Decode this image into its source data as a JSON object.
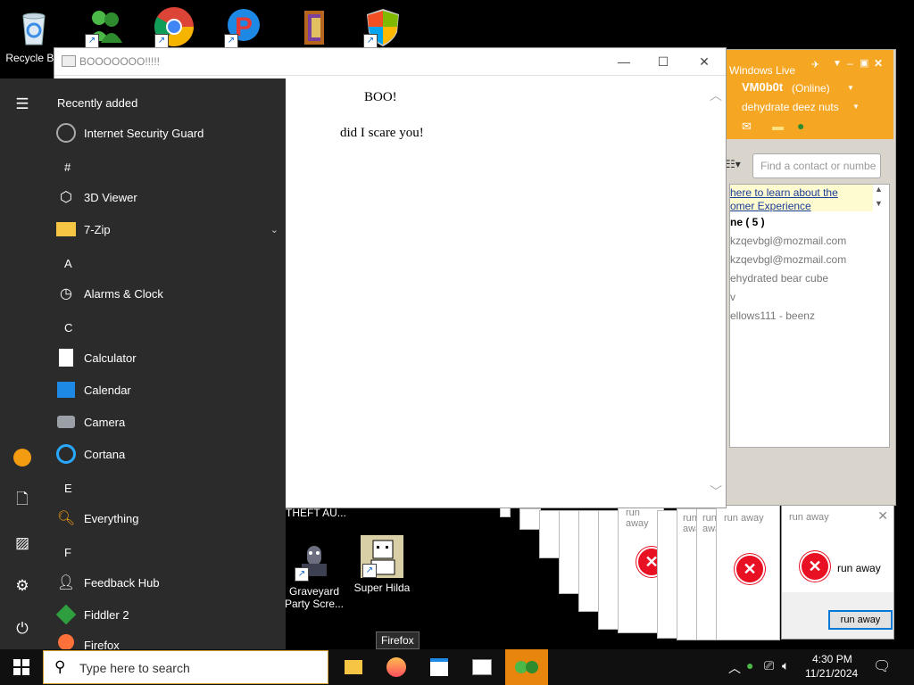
{
  "desktop": {
    "icons": [
      {
        "label": "Recycle Bin",
        "name": "recycle-bin"
      },
      {
        "label": "",
        "name": "messenger"
      },
      {
        "label": "",
        "name": "chrome"
      },
      {
        "label": "",
        "name": "pinball"
      },
      {
        "label": "",
        "name": "winrar"
      },
      {
        "label": "",
        "name": "security-shield"
      }
    ],
    "bottom_icons": [
      {
        "label": "THEFT AU...",
        "name": "gta"
      },
      {
        "label": "Graveyard Party Scre...",
        "name": "graveyard"
      },
      {
        "label": "Super Hilda",
        "name": "super-hilda"
      }
    ]
  },
  "start_menu": {
    "section_title": "Recently added",
    "items": [
      {
        "type": "app",
        "label": "Internet Security Guard",
        "icon": "security-guard-icon"
      },
      {
        "type": "letter",
        "label": "#"
      },
      {
        "type": "app",
        "label": "3D Viewer",
        "icon": "cube-icon"
      },
      {
        "type": "app",
        "label": "7-Zip",
        "icon": "folder-icon"
      },
      {
        "type": "letter",
        "label": "A"
      },
      {
        "type": "app",
        "label": "Alarms & Clock",
        "icon": "clock-icon"
      },
      {
        "type": "letter",
        "label": "C"
      },
      {
        "type": "app",
        "label": "Calculator",
        "icon": "calculator-icon"
      },
      {
        "type": "app",
        "label": "Calendar",
        "icon": "calendar-icon"
      },
      {
        "type": "app",
        "label": "Camera",
        "icon": "camera-icon"
      },
      {
        "type": "app",
        "label": "Cortana",
        "icon": "cortana-icon"
      },
      {
        "type": "letter",
        "label": "E"
      },
      {
        "type": "app",
        "label": "Everything",
        "icon": "search-icon"
      },
      {
        "type": "letter",
        "label": "F"
      },
      {
        "type": "app",
        "label": "Feedback Hub",
        "icon": "feedback-icon"
      },
      {
        "type": "app",
        "label": "Fiddler 2",
        "icon": "fiddler-icon"
      },
      {
        "type": "app",
        "label": "Firefox",
        "icon": "firefox-icon"
      }
    ]
  },
  "boo_window": {
    "title": "BOOOOOOO!!!!!",
    "line1": "BOO!",
    "line2": "did I scare you!"
  },
  "messenger": {
    "title": "Windows Live",
    "user": "VM0b0t",
    "status": "(Online)",
    "message": "dehydrate deez nuts",
    "search_placeholder": "Find a contact or number",
    "banner_line1": "here to learn about the",
    "banner_line2": "omer Experience",
    "group": "ne ( 5 )",
    "contacts": [
      "kzqevbgl@mozmail.com",
      "kzqevbgl@mozmail.com",
      "ehydrated bear cube",
      "v",
      "ellows111 - beenz"
    ]
  },
  "dialogs": {
    "title": "run away",
    "message": "run away",
    "button": "run away"
  },
  "taskbar": {
    "search_placeholder": "Type here to search",
    "tooltip": "Firefox",
    "time": "4:30 PM",
    "date": "11/21/2024"
  },
  "colors": {
    "start_bg": "#2b2b2b",
    "messenger_orange": "#f5a623",
    "error_red": "#e81123"
  }
}
